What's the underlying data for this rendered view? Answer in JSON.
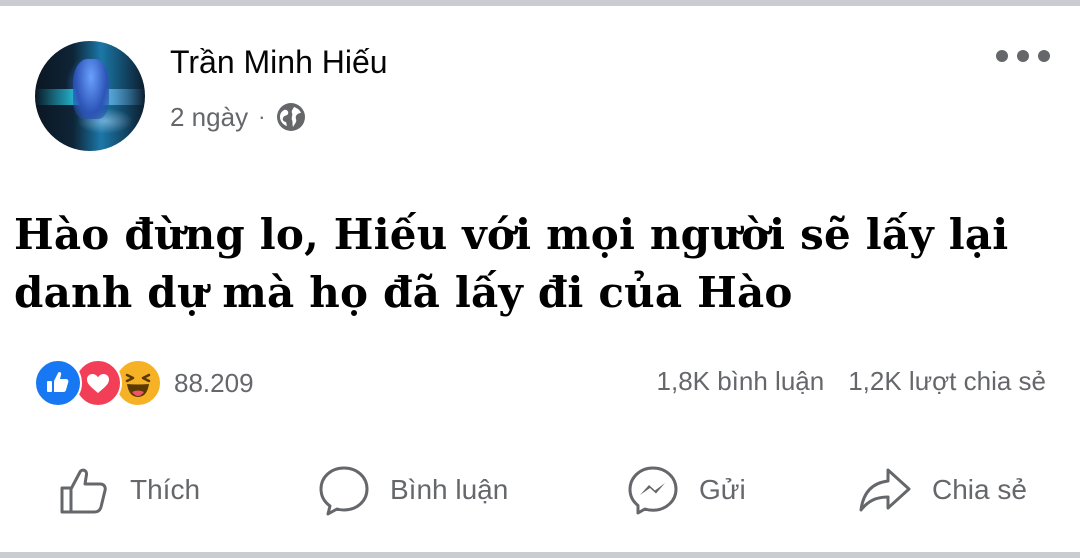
{
  "post": {
    "author_name": "Trần Minh Hiếu",
    "timestamp": "2 ngày",
    "separator": "·",
    "privacy_icon": "globe-icon",
    "more_icon": "ellipsis-icon",
    "text_line1": "Hào đừng lo, Hiếu với mọi người sẽ lấy lại",
    "text_line2": "danh dự mà họ đã lấy đi của Hào"
  },
  "reactions": {
    "icons": [
      "like-icon",
      "love-icon",
      "haha-icon"
    ],
    "count": "88.209",
    "comments": "1,8K bình luận",
    "shares": "1,2K lượt chia sẻ"
  },
  "actions": {
    "like_label": "Thích",
    "comment_label": "Bình luận",
    "send_label": "Gửi",
    "share_label": "Chia sẻ"
  },
  "colors": {
    "secondary_text": "#65676b",
    "like_blue": "#1877f2",
    "love_red": "#f33e58",
    "haha_yellow": "#f7b125",
    "divider": "#c9ccd1"
  }
}
